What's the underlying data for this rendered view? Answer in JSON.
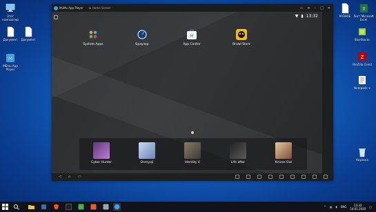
{
  "desktop": {
    "left_icons": [
      {
        "label": "Этот компьютер"
      },
      {
        "label": "Документ"
      },
      {
        "label": "Документ"
      },
      {
        "label": "MEmu App Player"
      }
    ],
    "right_icons": [
      {
        "label": "РАЗНОЕ"
      },
      {
        "label": "Лист Microsoft Excel"
      },
      {
        "label": "BlueStacks"
      },
      {
        "label": "FileZilla Client"
      },
      {
        "label": "Notepad++"
      },
      {
        "label": "Корзина"
      }
    ]
  },
  "emulator": {
    "title": "MuMu App Player",
    "tab_label": "Home Screen",
    "status_time": "13:32",
    "apps": [
      {
        "label": "System Apps",
        "icon": "system-apps-icon"
      },
      {
        "label": "Браузер",
        "icon": "browser-icon"
      },
      {
        "label": "App Center",
        "icon": "app-center-icon"
      },
      {
        "label": "Brawl Stars",
        "icon": "brawl-stars-icon"
      }
    ],
    "dock": [
      {
        "label": "Cyber Hunter"
      },
      {
        "label": "Onmyoji"
      },
      {
        "label": "Identity V"
      },
      {
        "label": "Life after"
      },
      {
        "label": "Knives Out"
      }
    ]
  },
  "taskbar": {
    "lang": "ENG",
    "time": "13:32",
    "date": "14.01.2020"
  },
  "colors": {
    "accent": "#2f8fe8",
    "taskbar": "#10131c"
  }
}
